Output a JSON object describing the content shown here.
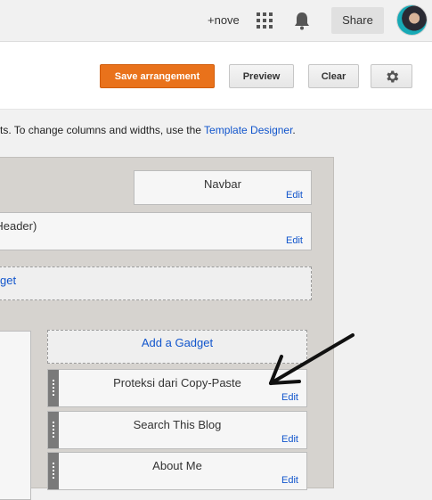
{
  "topbar": {
    "account_label": "+nove",
    "share_label": "Share",
    "icons": [
      "apps-grid-icon",
      "notifications-bell-icon",
      "avatar"
    ]
  },
  "toolbar": {
    "save_label": "Save arrangement",
    "preview_label": "Preview",
    "clear_label": "Clear",
    "settings_icon": "gear-icon",
    "save_color": "#e9721b"
  },
  "info": {
    "text": "ts. To change columns and widths, use the ",
    "link": "Template Designer",
    "suffix": "."
  },
  "layout": {
    "navbar": {
      "title": "Navbar",
      "edit": "Edit"
    },
    "header": {
      "title": "Header)",
      "prefix": "(",
      "edit": "Edit"
    },
    "add_gadget_top": "get",
    "add_gadget_sidebar": "Add a Gadget",
    "sidebar_gadgets": [
      {
        "title": "Proteksi dari Copy-Paste",
        "edit": "Edit"
      },
      {
        "title": "Search This Blog",
        "edit": "Edit"
      },
      {
        "title": "About Me",
        "edit": "Edit"
      }
    ]
  }
}
